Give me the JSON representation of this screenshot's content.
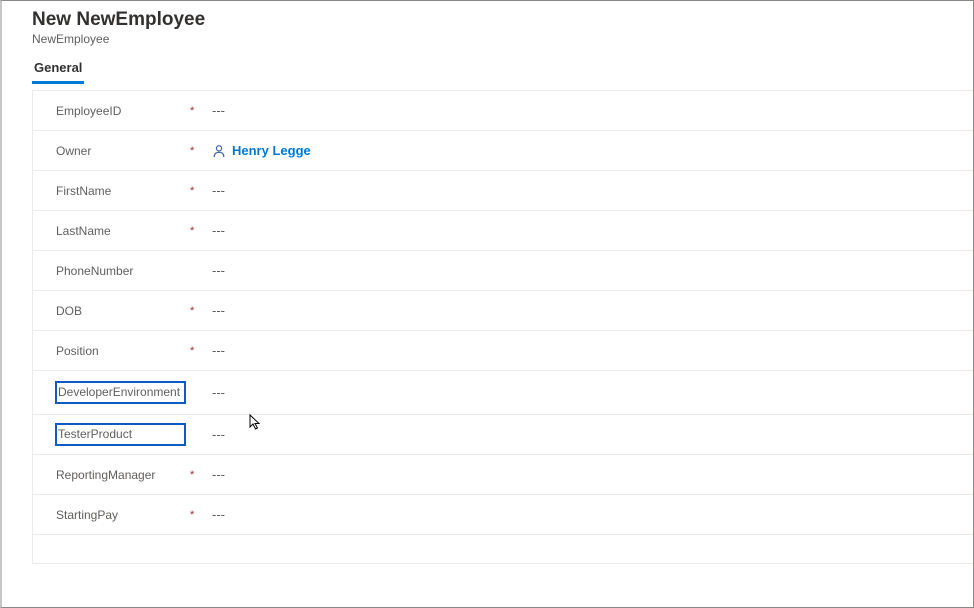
{
  "header": {
    "title": "New NewEmployee",
    "subtitle": "NewEmployee"
  },
  "tabs": {
    "general": "General"
  },
  "fields": {
    "employeeId": {
      "label": "EmployeeID",
      "required": "*",
      "value": "---"
    },
    "owner": {
      "label": "Owner",
      "required": "*",
      "value": "Henry Legge"
    },
    "firstName": {
      "label": "FirstName",
      "required": "*",
      "value": "---"
    },
    "lastName": {
      "label": "LastName",
      "required": "*",
      "value": "---"
    },
    "phoneNumber": {
      "label": "PhoneNumber",
      "required": "",
      "value": "---"
    },
    "dob": {
      "label": "DOB",
      "required": "*",
      "value": "---"
    },
    "position": {
      "label": "Position",
      "required": "*",
      "value": "---"
    },
    "developerEnvironment": {
      "label": "DeveloperEnvironment",
      "required": "",
      "value": "---"
    },
    "testerProduct": {
      "label": "TesterProduct",
      "required": "",
      "value": "---"
    },
    "reportingManager": {
      "label": "ReportingManager",
      "required": "*",
      "value": "---"
    },
    "startingPay": {
      "label": "StartingPay",
      "required": "*",
      "value": "---"
    }
  }
}
